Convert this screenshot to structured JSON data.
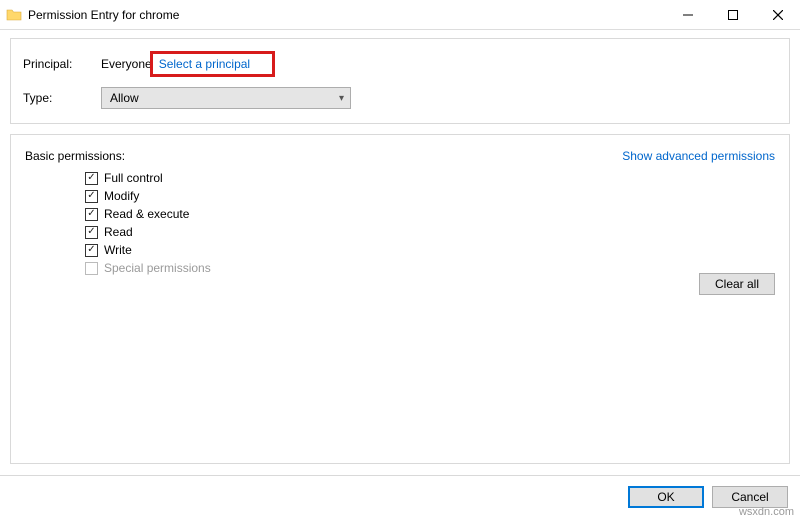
{
  "window": {
    "title": "Permission Entry for chrome"
  },
  "top": {
    "principal_label": "Principal:",
    "principal_value": "Everyone",
    "select_principal": "Select a principal",
    "type_label": "Type:",
    "type_value": "Allow"
  },
  "permissions": {
    "header": "Basic permissions:",
    "show_advanced": "Show advanced permissions",
    "items": [
      {
        "label": "Full control",
        "checked": true,
        "enabled": true
      },
      {
        "label": "Modify",
        "checked": true,
        "enabled": true
      },
      {
        "label": "Read & execute",
        "checked": true,
        "enabled": true
      },
      {
        "label": "Read",
        "checked": true,
        "enabled": true
      },
      {
        "label": "Write",
        "checked": true,
        "enabled": true
      },
      {
        "label": "Special permissions",
        "checked": false,
        "enabled": false
      }
    ],
    "clear_all": "Clear all"
  },
  "footer": {
    "ok": "OK",
    "cancel": "Cancel"
  },
  "watermark": "wsxdn.com"
}
